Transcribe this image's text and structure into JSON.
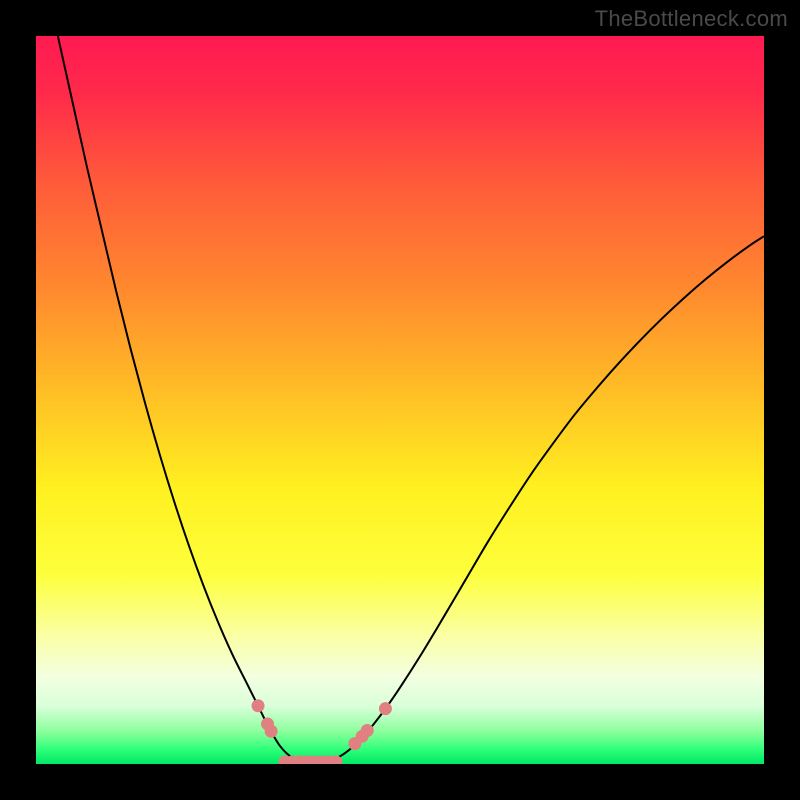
{
  "watermark": "TheBottleneck.com",
  "chart_data": {
    "type": "line",
    "title": "",
    "xlabel": "",
    "ylabel": "",
    "xlim": [
      0,
      100
    ],
    "ylim": [
      0,
      100
    ],
    "gradient_stops": [
      {
        "offset": 0,
        "color": "#ff1a52"
      },
      {
        "offset": 0.08,
        "color": "#ff2a4a"
      },
      {
        "offset": 0.2,
        "color": "#ff5a3a"
      },
      {
        "offset": 0.35,
        "color": "#ff8a2e"
      },
      {
        "offset": 0.5,
        "color": "#ffc225"
      },
      {
        "offset": 0.62,
        "color": "#fff020"
      },
      {
        "offset": 0.74,
        "color": "#fdff3c"
      },
      {
        "offset": 0.82,
        "color": "#faffa0"
      },
      {
        "offset": 0.88,
        "color": "#f3ffe0"
      },
      {
        "offset": 0.92,
        "color": "#daffda"
      },
      {
        "offset": 0.955,
        "color": "#8dff9d"
      },
      {
        "offset": 0.98,
        "color": "#2fff7a"
      },
      {
        "offset": 1.0,
        "color": "#00e865"
      }
    ],
    "series": [
      {
        "name": "left-curve",
        "color": "#000000",
        "points": [
          {
            "x": 3.0,
            "y": 100.0
          },
          {
            "x": 5.0,
            "y": 91.0
          },
          {
            "x": 7.0,
            "y": 82.0
          },
          {
            "x": 9.0,
            "y": 73.5
          },
          {
            "x": 11.0,
            "y": 65.0
          },
          {
            "x": 13.0,
            "y": 57.0
          },
          {
            "x": 15.0,
            "y": 49.5
          },
          {
            "x": 17.0,
            "y": 42.5
          },
          {
            "x": 19.0,
            "y": 36.0
          },
          {
            "x": 21.0,
            "y": 30.0
          },
          {
            "x": 23.0,
            "y": 24.5
          },
          {
            "x": 25.0,
            "y": 19.5
          },
          {
            "x": 27.0,
            "y": 15.0
          },
          {
            "x": 29.0,
            "y": 11.0
          },
          {
            "x": 30.5,
            "y": 8.0
          },
          {
            "x": 32.0,
            "y": 5.0
          },
          {
            "x": 33.5,
            "y": 2.5
          },
          {
            "x": 35.0,
            "y": 1.0
          },
          {
            "x": 36.5,
            "y": 0.3
          },
          {
            "x": 38.0,
            "y": 0.0
          }
        ]
      },
      {
        "name": "right-curve",
        "color": "#000000",
        "points": [
          {
            "x": 38.0,
            "y": 0.0
          },
          {
            "x": 40.0,
            "y": 0.3
          },
          {
            "x": 42.0,
            "y": 1.2
          },
          {
            "x": 44.0,
            "y": 2.8
          },
          {
            "x": 46.0,
            "y": 5.0
          },
          {
            "x": 48.0,
            "y": 7.6
          },
          {
            "x": 50.0,
            "y": 10.5
          },
          {
            "x": 53.0,
            "y": 15.2
          },
          {
            "x": 56.0,
            "y": 20.2
          },
          {
            "x": 59.0,
            "y": 25.3
          },
          {
            "x": 62.0,
            "y": 30.4
          },
          {
            "x": 65.0,
            "y": 35.2
          },
          {
            "x": 68.0,
            "y": 39.8
          },
          {
            "x": 71.0,
            "y": 44.0
          },
          {
            "x": 74.0,
            "y": 48.0
          },
          {
            "x": 77.0,
            "y": 51.6
          },
          {
            "x": 80.0,
            "y": 55.0
          },
          {
            "x": 83.0,
            "y": 58.2
          },
          {
            "x": 86.0,
            "y": 61.2
          },
          {
            "x": 89.0,
            "y": 64.0
          },
          {
            "x": 92.0,
            "y": 66.6
          },
          {
            "x": 95.0,
            "y": 69.0
          },
          {
            "x": 98.0,
            "y": 71.2
          },
          {
            "x": 100.0,
            "y": 72.5
          }
        ]
      }
    ],
    "markers": {
      "color": "#e08080",
      "radius": 6.5,
      "points": [
        {
          "x": 30.5,
          "y": 8.0
        },
        {
          "x": 31.8,
          "y": 5.5
        },
        {
          "x": 32.3,
          "y": 4.5
        },
        {
          "x": 34.2,
          "y": 0.3
        },
        {
          "x": 35.2,
          "y": 0.3
        },
        {
          "x": 36.2,
          "y": 0.3
        },
        {
          "x": 37.2,
          "y": 0.3
        },
        {
          "x": 38.2,
          "y": 0.3
        },
        {
          "x": 39.2,
          "y": 0.3
        },
        {
          "x": 40.2,
          "y": 0.3
        },
        {
          "x": 41.2,
          "y": 0.3
        },
        {
          "x": 43.8,
          "y": 2.8
        },
        {
          "x": 44.8,
          "y": 3.8
        },
        {
          "x": 45.5,
          "y": 4.6
        },
        {
          "x": 48.0,
          "y": 7.6
        }
      ]
    }
  }
}
